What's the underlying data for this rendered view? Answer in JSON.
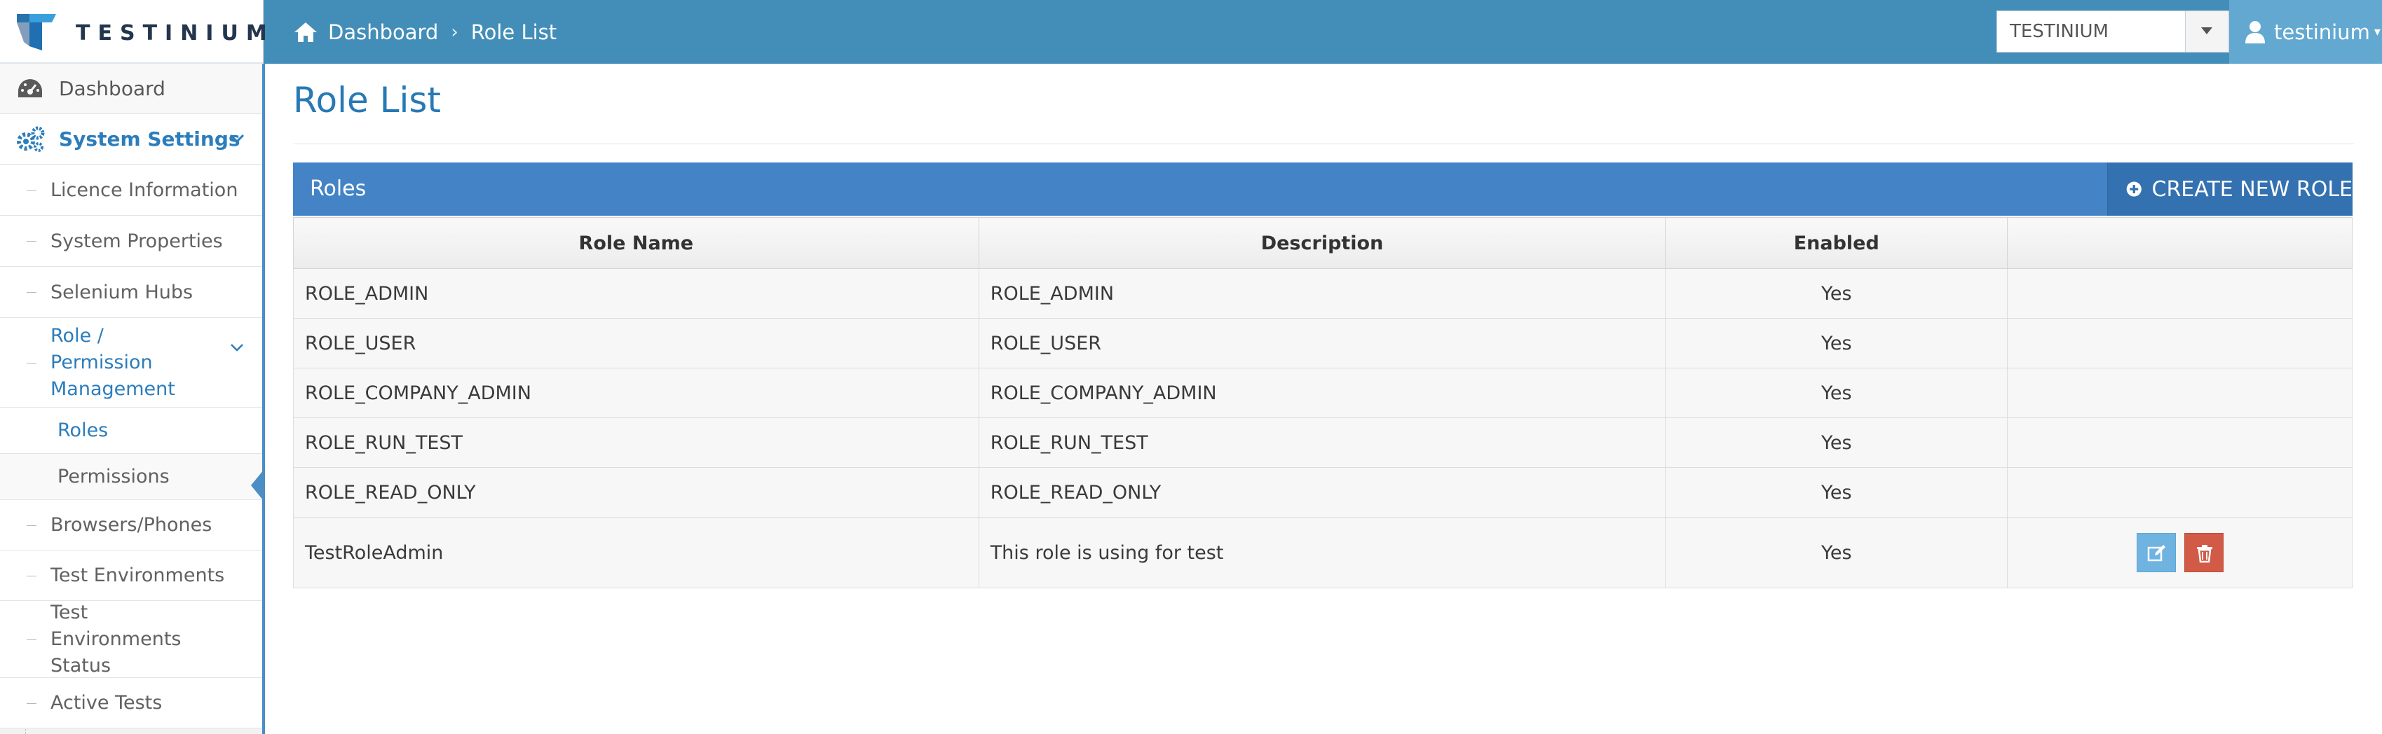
{
  "brand": {
    "name": "TESTINIUM"
  },
  "breadcrumb": {
    "home": "Dashboard",
    "current": "Role List"
  },
  "project_select": {
    "value": "TESTINIUM"
  },
  "user": {
    "name": "testinium"
  },
  "sidebar": {
    "dashboard": "Dashboard",
    "system_settings": "System Settings",
    "items": {
      "licence": "Licence Information",
      "properties": "System Properties",
      "hubs": "Selenium Hubs",
      "role_perm": "Role / Permission Management",
      "roles": "Roles",
      "permissions": "Permissions",
      "browsers": "Browsers/Phones",
      "test_env": "Test Environments",
      "test_env_status": "Test Environments Status",
      "active_tests": "Active Tests"
    }
  },
  "page": {
    "title": "Role List"
  },
  "panel": {
    "title": "Roles",
    "create_button": "CREATE NEW ROLE"
  },
  "table": {
    "headers": [
      "Role Name",
      "Description",
      "Enabled",
      ""
    ],
    "rows": [
      {
        "name": "ROLE_ADMIN",
        "description": "ROLE_ADMIN",
        "enabled": "Yes"
      },
      {
        "name": "ROLE_USER",
        "description": "ROLE_USER",
        "enabled": "Yes"
      },
      {
        "name": "ROLE_COMPANY_ADMIN",
        "description": "ROLE_COMPANY_ADMIN",
        "enabled": "Yes"
      },
      {
        "name": "ROLE_RUN_TEST",
        "description": "ROLE_RUN_TEST",
        "enabled": "Yes"
      },
      {
        "name": "ROLE_READ_ONLY",
        "description": "ROLE_READ_ONLY",
        "enabled": "Yes"
      },
      {
        "name": "TestRoleAdmin",
        "description": "This role is using for test",
        "enabled": "Yes"
      }
    ]
  },
  "colors": {
    "navbar": "#438eb9",
    "panel_header": "#4383c6",
    "link": "#2b7dbc",
    "edit": "#6fb3e0",
    "delete": "#d15b47"
  },
  "icons": [
    "home-icon",
    "user-icon",
    "dashboard-icon",
    "gears-icon",
    "chevron-down-icon",
    "plus-circle-icon",
    "edit-icon",
    "trash-icon"
  ]
}
